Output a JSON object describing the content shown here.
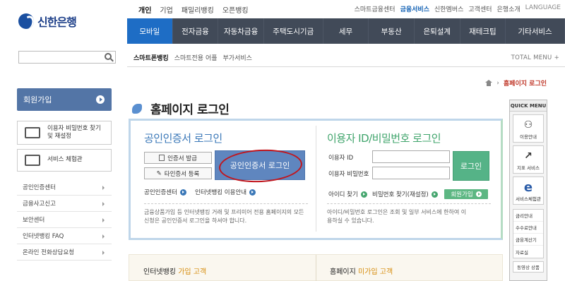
{
  "header": {
    "logo_text": "신한은행",
    "audience_tabs": [
      "개인",
      "기업",
      "패밀리뱅킹",
      "오픈뱅킹"
    ],
    "audience_active": "개인",
    "util_links": [
      "스마트금융센터",
      "금융서비스",
      "신한멤버스",
      "고객센터",
      "은행소개",
      "LANGUAGE"
    ],
    "util_active": "금융서비스"
  },
  "main_nav": {
    "items": [
      "모바일",
      "전자금융",
      "자동차금융",
      "주택도시기금",
      "세무",
      "부동산",
      "은퇴설계",
      "재테크팁",
      "기타서비스"
    ],
    "active": "모바일"
  },
  "search": {
    "value": "",
    "placeholder": ""
  },
  "sub_nav": {
    "items": [
      "스마트폰뱅킹",
      "스마트전용 어플",
      "부가서비스"
    ],
    "active": "스마트폰뱅킹",
    "total_menu": "TOTAL MENU +"
  },
  "breadcrumb": {
    "current": "홈페이지 로그인"
  },
  "sidebar": {
    "join_label": "회원가입",
    "box1_label": "이용자 비밀번호 찾기 및 재설정",
    "box2_label": "서비스 체험관",
    "links": [
      "공인인증센터",
      "금융사고신고",
      "보안센터",
      "인터넷뱅킹 FAQ",
      "온라인 전화상담요청"
    ]
  },
  "page_title": "홈페이지 로그인",
  "cert_panel": {
    "title": "공인인증서 로그인",
    "issue_button": "인증서 발급",
    "register_button": "타인증서 등록",
    "login_button": "공인인증서 로그인",
    "link1": "공인인증센터",
    "link2": "인터넷뱅킹 이용안내",
    "description": "금융상품가입 등 인터넷뱅킹 거래 및 프리미어 전용 홈페이지의 모든 신청은 공인인증서 로그인을 하셔야 합니다."
  },
  "id_panel": {
    "title": "이용자 ID/비밀번호 로그인",
    "id_label": "이용자 ID",
    "pw_label": "이용자 비밀번호",
    "id_value": "",
    "pw_value": "",
    "login_button": "로그인",
    "link1": "아이디 찾기",
    "link2": "비밀번호 찾기(재설정)",
    "join_button": "회원가입",
    "description": "아이디/비밀번호 로그인은 조회 및 일부 서비스에 한하여 이용하실 수 있습니다."
  },
  "bottom": {
    "left_prefix": "인터넷뱅킹 ",
    "left_highlight": "가입 고객",
    "right_prefix": "홈페이지 ",
    "right_highlight": "미가입 고객"
  },
  "quick_menu": {
    "title": "QUICK MENU",
    "icons": [
      {
        "label": "이용안내",
        "icon": "guide-icon"
      },
      {
        "label": "지표 서비스",
        "icon": "chart-icon"
      },
      {
        "label": "서비스체험관",
        "icon": "explorer-icon"
      }
    ],
    "list": [
      "금리안내",
      "수수료안내",
      "금융계산기",
      "자료실"
    ],
    "bottom": "동영상 상품"
  }
}
